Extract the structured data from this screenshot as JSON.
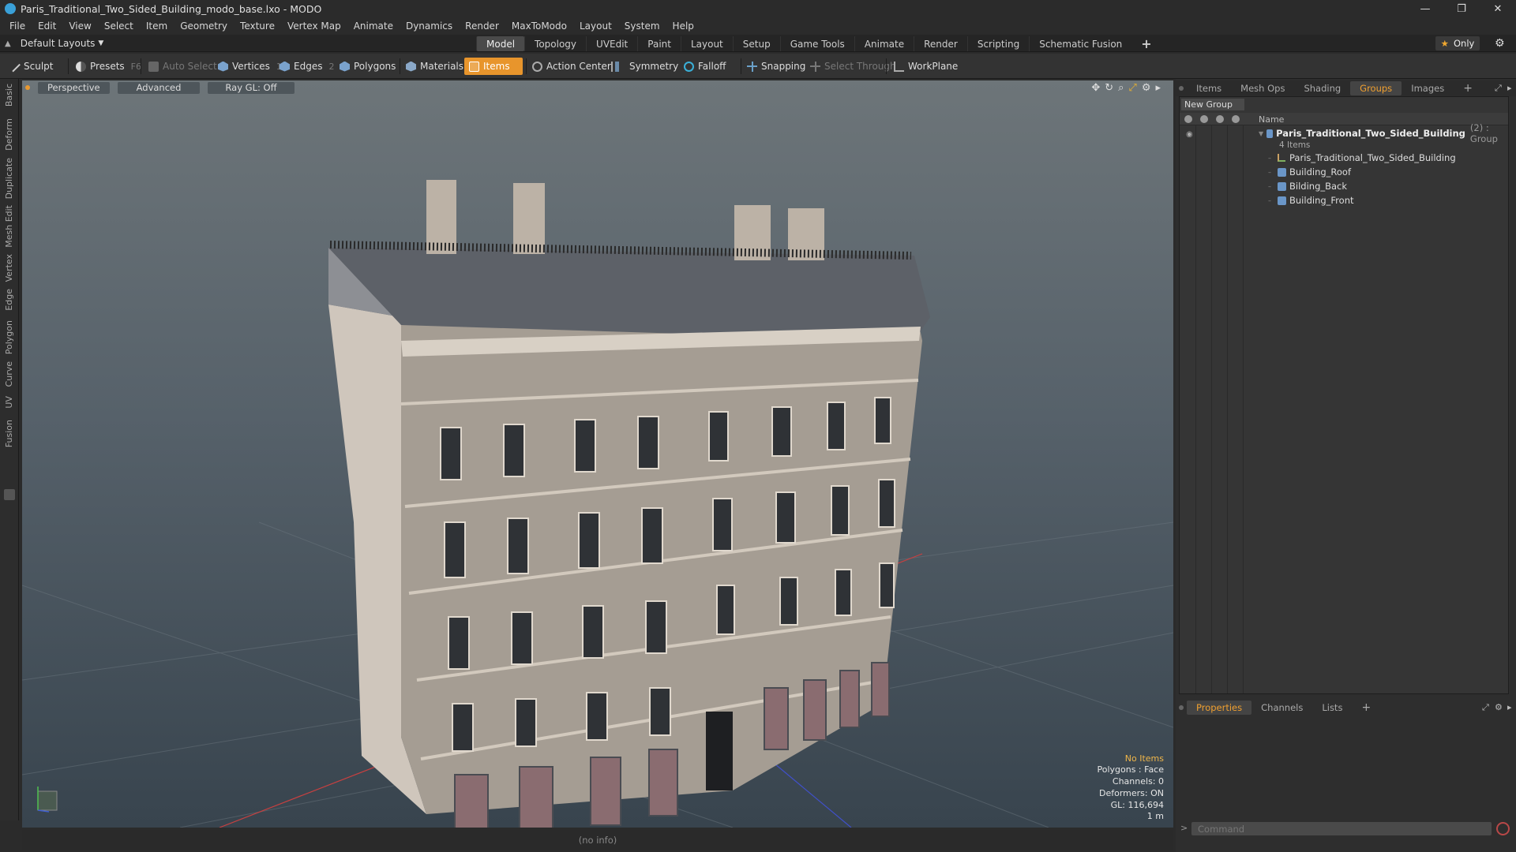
{
  "window": {
    "title": "Paris_Traditional_Two_Sided_Building_modo_base.lxo - MODO",
    "controls": [
      "—",
      "❐",
      "✕"
    ]
  },
  "menu": [
    "File",
    "Edit",
    "View",
    "Select",
    "Item",
    "Geometry",
    "Texture",
    "Vertex Map",
    "Animate",
    "Dynamics",
    "Render",
    "MaxToModo",
    "Layout",
    "System",
    "Help"
  ],
  "layout_selector": "Default Layouts",
  "tabs": [
    "Model",
    "Topology",
    "UVEdit",
    "Paint",
    "Layout",
    "Setup",
    "Game Tools",
    "Animate",
    "Render",
    "Scripting",
    "Schematic Fusion"
  ],
  "active_tab": "Model",
  "only_button": "Only",
  "toolbar": {
    "sculpt": "Sculpt",
    "presets": "Presets",
    "presets_key": "F6",
    "auto_select": "Auto Select",
    "vertices": "Vertices",
    "vertices_count": "1",
    "edges": "Edges",
    "edges_count": "2",
    "polygons": "Polygons",
    "materials": "Materials",
    "items": "Items",
    "action_center": "Action Center",
    "symmetry": "Symmetry",
    "falloff": "Falloff",
    "snapping": "Snapping",
    "select_through": "Select Through",
    "workplane": "WorkPlane"
  },
  "left_tabs": [
    "Basic",
    "Deform",
    "Duplicate",
    "Mesh Edit",
    "Vertex",
    "Edge",
    "Polygon",
    "Curve",
    "UV",
    "Fusion"
  ],
  "viewport": {
    "view": "Perspective",
    "shading": "Advanced",
    "raygl": "Ray GL: Off",
    "info": {
      "no_items": "No Items",
      "polygons": "Polygons : Face",
      "channels": "Channels: 0",
      "deformers": "Deformers: ON",
      "gl": "GL: 116,694",
      "scale": "1 m"
    }
  },
  "status": "(no info)",
  "right_panel": {
    "tabs": [
      "Items",
      "Mesh Ops",
      "Shading",
      "Groups",
      "Images"
    ],
    "active_tab": "Groups",
    "new_group": "New Group",
    "column_name": "Name",
    "group": {
      "name": "Paris_Traditional_Two_Sided_Building",
      "meta": "(2) : Group",
      "count": "4 Items",
      "children": [
        "Paris_Traditional_Two_Sided_Building",
        "Building_Roof",
        "Bilding_Back",
        "Building_Front"
      ]
    },
    "bottom_tabs": [
      "Properties",
      "Channels",
      "Lists"
    ],
    "bottom_active": "Properties",
    "command_placeholder": "Command"
  },
  "colors": {
    "accent": "#e8952c",
    "active_tab_text": "#f0a030",
    "viewport_top": "#6d7579",
    "viewport_bottom": "#38444e"
  }
}
